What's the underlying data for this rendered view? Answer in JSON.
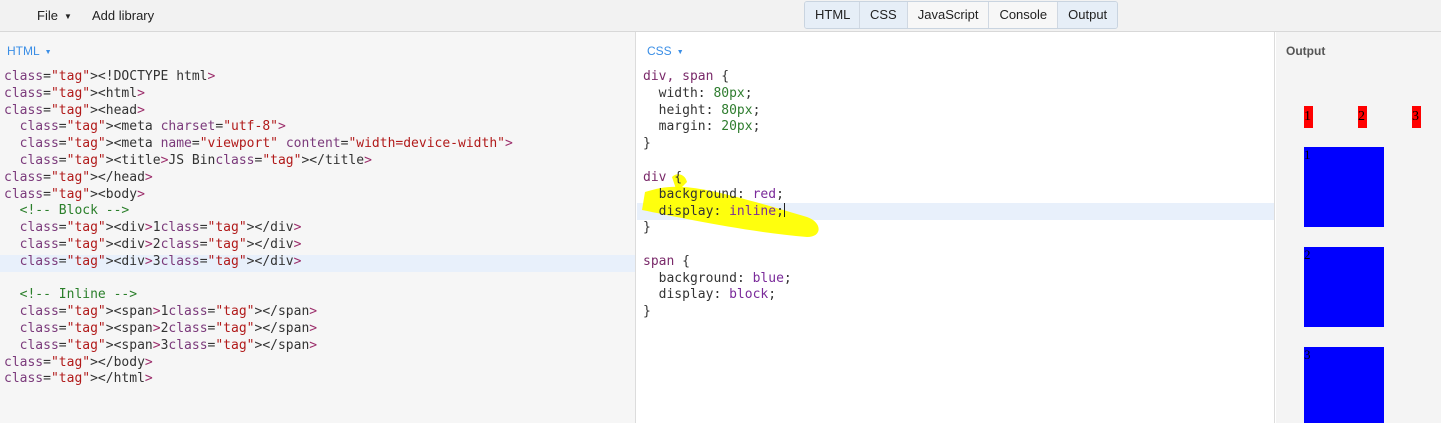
{
  "menu": {
    "file": "File",
    "add_library": "Add library"
  },
  "toggles": [
    "HTML",
    "CSS",
    "JavaScript",
    "Console",
    "Output"
  ],
  "panels": {
    "html": "HTML",
    "css": "CSS",
    "output": "Output"
  },
  "html_code": [
    "<!DOCTYPE html>",
    "<html>",
    "<head>",
    "  <meta charset=\"utf-8\">",
    "  <meta name=\"viewport\" content=\"width=device-width\">",
    "  <title>JS Bin</title>",
    "</head>",
    "<body>",
    "  <!-- Block -->",
    "  <div>1</div>",
    "  <div>2</div>",
    "  <div>3</div>",
    "",
    "  <!-- Inline -->",
    "  <span>1</span>",
    "  <span>2</span>",
    "  <span>3</span>",
    "</body>",
    "</html>"
  ],
  "css_code": [
    "div, span {",
    "  width: 80px;",
    "  height: 80px;",
    "  margin: 20px;",
    "}",
    "",
    "div {",
    "  background: red;",
    "  display: inline;",
    "}",
    "",
    "span {",
    "  background: blue;",
    "  display: block;",
    "}"
  ],
  "output": {
    "divs": [
      "1",
      "2",
      "3"
    ],
    "spans": [
      "1",
      "2",
      "3"
    ],
    "div_color": "#ff0000",
    "span_color": "#0000ff"
  },
  "highlight_color": "#ffff00"
}
